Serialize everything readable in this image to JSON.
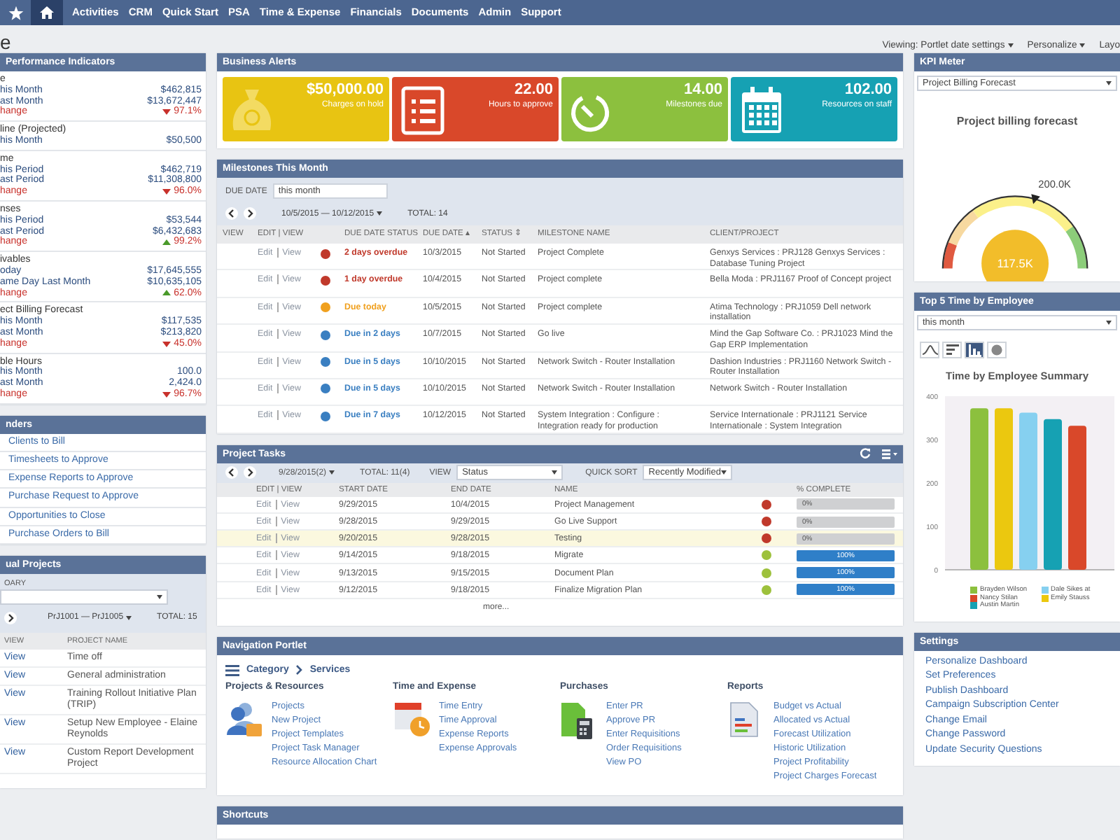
{
  "nav": {
    "home": {
      "selected": true
    },
    "items": [
      {
        "label": "Activities",
        "selected": false
      },
      {
        "label": "CRM",
        "selected": false
      },
      {
        "label": "Quick Start",
        "selected": false
      },
      {
        "label": "PSA",
        "selected": false
      },
      {
        "label": "Time & Expense",
        "selected": false
      },
      {
        "label": "Financials",
        "selected": false
      },
      {
        "label": "Documents",
        "selected": false
      },
      {
        "label": "Admin",
        "selected": false
      },
      {
        "label": "Support",
        "selected": false
      }
    ]
  },
  "page_title": "e",
  "page_links": [
    {
      "label": "Viewing: Portlet date settings",
      "kind": "menu"
    },
    {
      "label": "Personalize",
      "kind": "menu"
    },
    {
      "label": "Layo",
      "kind": "plain"
    }
  ],
  "kpi": {
    "title": "Performance Indicators",
    "groups": [
      {
        "title": "e",
        "rows": [
          {
            "kind": "value",
            "label": "his Month",
            "value": "$462,815"
          },
          {
            "kind": "value",
            "label": "ast Month",
            "value": "$13,672,447"
          },
          {
            "kind": "change",
            "label": "hange",
            "value": "97.1%",
            "rising": false
          }
        ]
      },
      {
        "title": "line (Projected)",
        "rows": [
          {
            "kind": "value",
            "label": "his Month",
            "value": "$50,500"
          }
        ]
      },
      {
        "title": "me",
        "rows": [
          {
            "kind": "value",
            "label": "his Period",
            "value": "$462,719"
          },
          {
            "kind": "value",
            "label": "ast Period",
            "value": "$11,308,800"
          },
          {
            "kind": "change",
            "label": "hange",
            "value": "96.0%",
            "rising": false
          }
        ]
      },
      {
        "title": "nses",
        "rows": [
          {
            "kind": "value",
            "label": "his Period",
            "value": "$53,544"
          },
          {
            "kind": "value",
            "label": "ast Period",
            "value": "$6,432,683"
          },
          {
            "kind": "change",
            "label": "hange",
            "value": "99.2%",
            "rising": true
          }
        ]
      },
      {
        "title": "ivables",
        "rows": [
          {
            "kind": "value",
            "label": "oday",
            "value": "$17,645,555"
          },
          {
            "kind": "value",
            "label": "ame Day Last Month",
            "value": "$10,635,105"
          },
          {
            "kind": "change",
            "label": "hange",
            "value": "62.0%",
            "rising": true
          }
        ]
      },
      {
        "title": "ect Billing Forecast",
        "rows": [
          {
            "kind": "value",
            "label": "his Month",
            "value": "$117,535"
          },
          {
            "kind": "value",
            "label": "ast Month",
            "value": "$213,820"
          },
          {
            "kind": "change",
            "label": "hange",
            "value": "45.0%",
            "rising": false
          }
        ]
      },
      {
        "title": "ble Hours",
        "rows": [
          {
            "kind": "value",
            "label": "his Month",
            "value": "100.0"
          },
          {
            "kind": "value",
            "label": "ast Month",
            "value": "2,424.0"
          },
          {
            "kind": "change",
            "label": "hange",
            "value": "96.7%",
            "rising": false
          }
        ]
      }
    ]
  },
  "reminders": {
    "title": "nders",
    "items": [
      "Clients to Bill",
      "Timesheets to Approve",
      "Expense Reports to Approve",
      "Purchase Request to Approve",
      "Opportunities to Close",
      "Purchase Orders to Bill"
    ]
  },
  "projects": {
    "title": "ual Projects",
    "filter_label": "OARY",
    "range": "PrJ1001 — PrJ1005",
    "total": "TOTAL: 15",
    "columns": [
      "VIEW",
      "PROJECT NAME"
    ],
    "rows": [
      {
        "view": "View",
        "name": "Time off"
      },
      {
        "view": "View",
        "name": "General administration"
      },
      {
        "view": "View",
        "name": "Training Rollout Initiative Plan (TRIP)"
      },
      {
        "view": "View",
        "name": "Setup New Employee - Elaine Reynolds"
      },
      {
        "view": "View",
        "name": "Custom Report Development Project"
      }
    ]
  },
  "business_alerts": {
    "title": "Business Alerts",
    "tiles": [
      {
        "kind": "money",
        "value": "$50,000.00",
        "label": "Charges on hold",
        "color": "#e8c412"
      },
      {
        "kind": "list",
        "value": "22.00",
        "label": "Hours to approve",
        "color": "#d9482a"
      },
      {
        "kind": "timer",
        "value": "14.00",
        "label": "Milestones due",
        "color": "#8cc03e"
      },
      {
        "kind": "calendar",
        "value": "102.00",
        "label": "Resources on staff",
        "color": "#16a1b3"
      }
    ]
  },
  "milestones": {
    "title": "Milestones This Month",
    "due_date_label": "DUE DATE",
    "due_date_value": "this month",
    "range": "10/5/2015 — 10/12/2015",
    "total": "TOTAL: 14",
    "columns": [
      "VIEW",
      "EDIT | VIEW",
      "",
      "DUE DATE STATUS",
      "DUE DATE ▴",
      "STATUS ⇕",
      "MILESTONE NAME",
      "CLIENT/PROJECT"
    ],
    "rows": [
      {
        "edit": "Edit",
        "view": "View",
        "color": "#c0392b",
        "due_status": "2 days overdue",
        "due_date": "10/3/2015",
        "status": "Not Started",
        "name": "Project Complete",
        "client": "Genxys Services : PRJ128 Genxys Services : Database Tuning Project"
      },
      {
        "edit": "Edit",
        "view": "View",
        "color": "#c0392b",
        "due_status": "1 day overdue",
        "due_date": "10/4/2015",
        "status": "Not Started",
        "name": "Project complete",
        "client": "Bella Moda : PRJ1167 Proof of Concept project"
      },
      {
        "edit": "Edit",
        "view": "View",
        "color": "#f0a01e",
        "due_status": "Due today",
        "due_date": "10/5/2015",
        "status": "Not Started",
        "name": "Project complete",
        "client": "Atima Technology : PRJ1059 Dell network installation"
      },
      {
        "edit": "Edit",
        "view": "View",
        "color": "#3a7fc1",
        "due_status": "Due in 2 days",
        "due_date": "10/7/2015",
        "status": "Not Started",
        "name": "Go live",
        "client": "Mind the Gap Software Co. : PRJ1023 Mind the Gap ERP Implementation"
      },
      {
        "edit": "Edit",
        "view": "View",
        "color": "#3a7fc1",
        "due_status": "Due in 5 days",
        "due_date": "10/10/2015",
        "status": "Not Started",
        "name": "Network Switch - Router Installation",
        "client": "Dashion Industries : PRJ1160 Network Switch - Router Installation"
      },
      {
        "edit": "Edit",
        "view": "View",
        "color": "#3a7fc1",
        "due_status": "Due in 5 days",
        "due_date": "10/10/2015",
        "status": "Not Started",
        "name": "Network Switch - Router Installation",
        "client": "Network Switch - Router Installation"
      },
      {
        "edit": "Edit",
        "view": "View",
        "color": "#3a7fc1",
        "due_status": "Due in 7 days",
        "due_date": "10/12/2015",
        "status": "Not Started",
        "name": "System Integration : Configure : Integration ready for production",
        "client": "Service Internationale : PRJ1121 Service Internationale : System Integration"
      }
    ]
  },
  "project_tasks": {
    "title": "Project Tasks",
    "range": "9/28/2015(2)",
    "total": "TOTAL: 11(4)",
    "view_label": "VIEW",
    "view_value": "Status",
    "sort_label": "QUICK SORT",
    "sort_value": "Recently Modified",
    "columns": [
      "EDIT | VIEW",
      "START DATE",
      "END DATE",
      "NAME",
      "% COMPLETE"
    ],
    "rows": [
      {
        "edit": "Edit",
        "view": "View",
        "start": "9/29/2015",
        "end": "10/4/2015",
        "name": "Project Management",
        "color": "#c0392b",
        "level": 0,
        "percent": "0%",
        "selected": false
      },
      {
        "edit": "Edit",
        "view": "View",
        "start": "9/28/2015",
        "end": "9/29/2015",
        "name": "Go Live Support",
        "color": "#c0392b",
        "level": 0,
        "percent": "0%",
        "selected": false
      },
      {
        "edit": "Edit",
        "view": "View",
        "start": "9/20/2015",
        "end": "9/28/2015",
        "name": "Testing",
        "color": "#c0392b",
        "level": 0,
        "percent": "0%",
        "selected": true
      },
      {
        "edit": "Edit",
        "view": "View",
        "start": "9/14/2015",
        "end": "9/18/2015",
        "name": "Migrate",
        "color": "#9dc13c",
        "level": 1,
        "percent": "100%",
        "selected": false
      },
      {
        "edit": "Edit",
        "view": "View",
        "start": "9/13/2015",
        "end": "9/15/2015",
        "name": "Document Plan",
        "color": "#9dc13c",
        "level": 1,
        "percent": "100%",
        "selected": false
      },
      {
        "edit": "Edit",
        "view": "View",
        "start": "9/12/2015",
        "end": "9/18/2015",
        "name": "Finalize Migration Plan",
        "color": "#9dc13c",
        "level": 1,
        "percent": "100%",
        "selected": false
      }
    ],
    "more": "more..."
  },
  "navigation": {
    "title": "Navigation Portlet",
    "crumbs": [
      "Category",
      "Services"
    ],
    "sections": [
      {
        "kind": "people",
        "title": "Projects & Resources",
        "links": [
          "Projects",
          "New Project",
          "Project Templates",
          "Project Task Manager",
          "Resource Allocation Chart"
        ]
      },
      {
        "kind": "calendar",
        "title": "Time and Expense",
        "links": [
          "Time Entry",
          "Time Approval",
          "Expense Reports",
          "Expense Approvals"
        ]
      },
      {
        "kind": "calculator",
        "title": "Purchases",
        "links": [
          "Enter PR",
          "Approve PR",
          "Enter Requisitions",
          "Order Requisitions",
          "View PO"
        ]
      },
      {
        "kind": "report",
        "title": "Reports",
        "links": [
          "Budget vs Actual",
          "Allocated vs Actual",
          "Forecast Utilization",
          "Historic Utilization",
          "Project Profitability",
          "Project Charges Forecast"
        ]
      }
    ]
  },
  "shortcuts": {
    "title": "Shortcuts"
  },
  "kpi_meter": {
    "title": "KPI Meter",
    "select": "Project Billing Forecast",
    "gauge_title": "Project billing forecast",
    "max_label": "200.0K",
    "value_label": "117.5K",
    "level": 0.5875
  },
  "time_by_employee": {
    "title": "Top 5 Time by Employee",
    "select": "this month",
    "chart_types": [
      {
        "kind": "line",
        "selected": false
      },
      {
        "kind": "hbar",
        "selected": false
      },
      {
        "kind": "bar",
        "selected": true
      },
      {
        "kind": "pie",
        "selected": false
      }
    ],
    "chart_data": {
      "type": "bar",
      "title": "Time by Employee Summary",
      "ylim": [
        0,
        400
      ],
      "yticks": [
        0,
        100,
        200,
        300,
        400
      ],
      "series": [
        {
          "name": "Brayden Wilson",
          "color": "#8cc03e",
          "values": [
            372
          ]
        },
        {
          "name": "Emily Stauss",
          "color": "#ebc80f",
          "values": [
            372
          ]
        },
        {
          "name": "Dale Sikes at",
          "color": "#86d0f0",
          "values": [
            362
          ]
        },
        {
          "name": "Austin Martin",
          "color": "#16a1b3",
          "values": [
            347
          ]
        },
        {
          "name": "Nancy Stilan",
          "color": "#d9482a",
          "values": [
            332
          ]
        }
      ]
    }
  },
  "settings": {
    "title": "Settings",
    "items": [
      "Personalize Dashboard",
      "Set Preferences",
      "Publish Dashboard",
      "Campaign Subscription Center",
      "Change Email",
      "Change Password",
      "Update Security Questions"
    ]
  }
}
